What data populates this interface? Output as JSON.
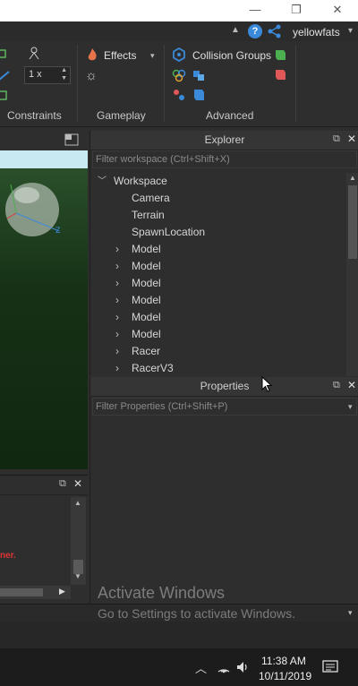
{
  "titlebar": {
    "minimize": "—",
    "restore": "❐",
    "close": "✕",
    "username": "yellowfats"
  },
  "ribbon": {
    "constraints": {
      "scale_value": "1 x",
      "group_label": "Constraints"
    },
    "gameplay": {
      "effects_label": "Effects",
      "group_label": "Gameplay"
    },
    "advanced": {
      "collision_groups_label": "Collision Groups",
      "group_label": "Advanced"
    }
  },
  "explorer": {
    "title": "Explorer",
    "filter_placeholder": "Filter workspace (Ctrl+Shift+X)",
    "tree": [
      {
        "label": "Workspace",
        "expanded": true,
        "depth": 0
      },
      {
        "label": "Camera",
        "depth": 1
      },
      {
        "label": "Terrain",
        "depth": 1
      },
      {
        "label": "SpawnLocation",
        "depth": 1
      },
      {
        "label": "Model",
        "depth": 1,
        "collapsed": true
      },
      {
        "label": "Model",
        "depth": 1,
        "collapsed": true
      },
      {
        "label": "Model",
        "depth": 1,
        "collapsed": true
      },
      {
        "label": "Model",
        "depth": 1,
        "collapsed": true
      },
      {
        "label": "Model",
        "depth": 1,
        "collapsed": true
      },
      {
        "label": "Model",
        "depth": 1,
        "collapsed": true
      },
      {
        "label": "Racer",
        "depth": 1,
        "collapsed": true
      },
      {
        "label": "RacerV3",
        "depth": 1,
        "collapsed": true
      }
    ]
  },
  "properties": {
    "title": "Properties",
    "filter_placeholder": "Filter Properties (Ctrl+Shift+P)"
  },
  "output": {
    "error_fragment": "ner."
  },
  "watermark": {
    "title": "Activate Windows",
    "subtitle": "Go to Settings to activate Windows."
  },
  "taskbar": {
    "time": "11:38 AM",
    "date": "10/11/2019"
  },
  "colors": {
    "accent_blue": "#3b8ad9",
    "error_red": "#e03434",
    "viewport_green": "#173517"
  }
}
